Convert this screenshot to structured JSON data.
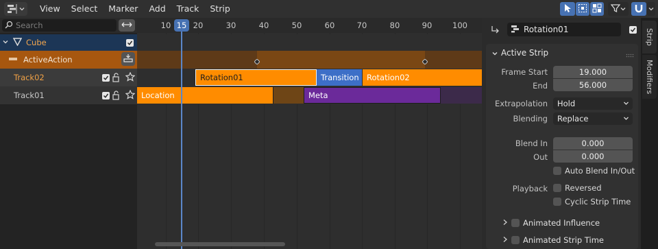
{
  "header": {
    "menu": [
      "View",
      "Select",
      "Marker",
      "Add",
      "Track",
      "Strip"
    ]
  },
  "channels": {
    "search_placeholder": "Search",
    "object": "Cube",
    "action": "ActiveAction",
    "tracks": [
      "Track02",
      "Track01"
    ]
  },
  "timeline": {
    "ticks": [
      "10",
      "20",
      "30",
      "40",
      "50",
      "60",
      "70",
      "80",
      "90",
      "100"
    ],
    "current_frame": "15",
    "strips": {
      "rotation01": "Rotation01",
      "transition": "Transition",
      "rotation02": "Rotation02",
      "location": "Location",
      "meta": "Meta"
    }
  },
  "sidebar": {
    "strip_name": "Rotation01",
    "panel_title": "Active Strip",
    "frame_start_label": "Frame Start",
    "frame_start": "19.000",
    "end_label": "End",
    "end": "56.000",
    "extrapolation_label": "Extrapolation",
    "extrapolation": "Hold",
    "blending_label": "Blending",
    "blending": "Replace",
    "blend_in_label": "Blend In",
    "blend_in": "0.000",
    "blend_out_label": "Out",
    "blend_out": "0.000",
    "auto_blend": "Auto Blend In/Out",
    "playback_label": "Playback",
    "reversed": "Reversed",
    "cyclic": "Cyclic Strip Time",
    "animated_influence": "Animated Influence",
    "animated_strip_time": "Animated Strip Time"
  },
  "tabs": [
    "Strip",
    "Modifiers"
  ],
  "colors": {
    "accent": "#4772b3",
    "action_strip": "#ff8c00",
    "transition_strip": "#3d6fc7",
    "meta_strip": "#6b2a9a"
  }
}
